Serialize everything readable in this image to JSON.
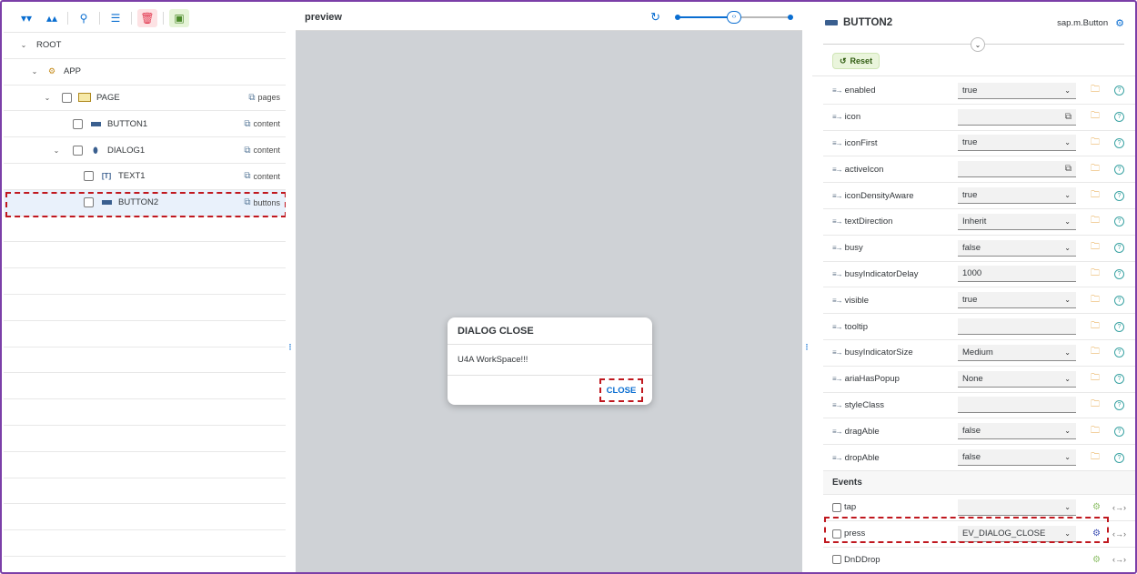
{
  "toolbar": {
    "expand_icon": "expand-all-icon",
    "collapse_icon": "collapse-all-icon",
    "search_icon": "search-icon",
    "outline_icon": "outline-icon",
    "delete_icon": "trash-icon",
    "preview_icon": "preview-icon"
  },
  "tree": [
    {
      "label": "ROOT",
      "aggregation": ""
    },
    {
      "label": "APP",
      "aggregation": ""
    },
    {
      "label": "PAGE",
      "aggregation": "pages"
    },
    {
      "label": "BUTTON1",
      "aggregation": "content"
    },
    {
      "label": "DIALOG1",
      "aggregation": "content"
    },
    {
      "label": "TEXT1",
      "aggregation": "content"
    },
    {
      "label": "BUTTON2",
      "aggregation": "buttons"
    }
  ],
  "preview": {
    "title": "preview",
    "dialog_title": "DIALOG CLOSE",
    "dialog_text": "U4A WorkSpace!!!",
    "dialog_button": "CLOSE",
    "zoom_level": 0.5
  },
  "properties": {
    "title": "BUTTON2",
    "class_name": "sap.m.Button",
    "reset_label": "Reset",
    "items": [
      {
        "name": "enabled",
        "value": "true"
      },
      {
        "name": "icon",
        "value": ""
      },
      {
        "name": "iconFirst",
        "value": "true"
      },
      {
        "name": "activeIcon",
        "value": ""
      },
      {
        "name": "iconDensityAware",
        "value": "true"
      },
      {
        "name": "textDirection",
        "value": "Inherit"
      },
      {
        "name": "busy",
        "value": "false"
      },
      {
        "name": "busyIndicatorDelay",
        "value": "1000"
      },
      {
        "name": "visible",
        "value": "true"
      },
      {
        "name": "tooltip",
        "value": ""
      },
      {
        "name": "busyIndicatorSize",
        "value": "Medium"
      },
      {
        "name": "ariaHasPopup",
        "value": "None"
      },
      {
        "name": "styleClass",
        "value": ""
      },
      {
        "name": "dragAble",
        "value": "false"
      },
      {
        "name": "dropAble",
        "value": "false"
      }
    ],
    "events_header": "Events",
    "events": [
      {
        "name": "tap",
        "value": ""
      },
      {
        "name": "press",
        "value": "EV_DIALOG_CLOSE"
      },
      {
        "name": "DnDDrop",
        "value": ""
      }
    ]
  },
  "colors": {
    "accent": "#0a6ed1",
    "highlight": "#c0181f",
    "frame": "#7b3fa8"
  }
}
